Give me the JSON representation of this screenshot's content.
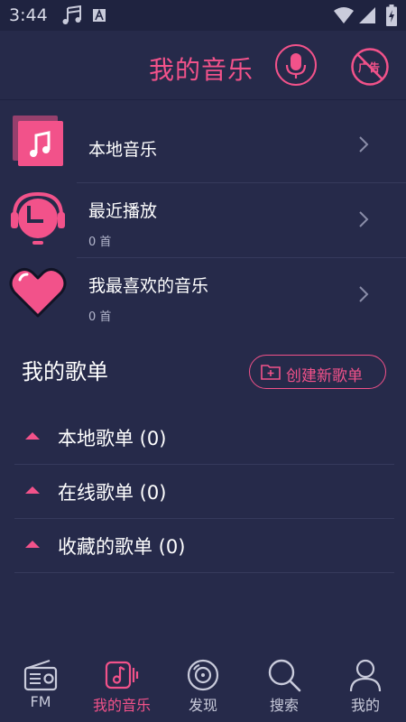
{
  "status_bar": {
    "time": "3:44"
  },
  "header": {
    "title": "我的音乐",
    "ad_label": "广告"
  },
  "library": [
    {
      "title": "本地音乐",
      "subtitle": ""
    },
    {
      "title": "最近播放",
      "subtitle": "0 首"
    },
    {
      "title": "我最喜欢的音乐",
      "subtitle": "0 首"
    }
  ],
  "playlists": {
    "title": "我的歌单",
    "create_label": "创建新歌单",
    "groups": [
      {
        "label": "本地歌单 (0)"
      },
      {
        "label": "在线歌单 (0)"
      },
      {
        "label": "收藏的歌单 (0)"
      }
    ]
  },
  "bottom_nav": [
    {
      "label": "FM",
      "icon": "radio-icon",
      "active": false
    },
    {
      "label": "我的音乐",
      "icon": "music-note-icon",
      "active": true
    },
    {
      "label": "发现",
      "icon": "disc-icon",
      "active": false
    },
    {
      "label": "搜索",
      "icon": "search-icon",
      "active": false
    },
    {
      "label": "我的",
      "icon": "user-icon",
      "active": false
    }
  ],
  "colors": {
    "accent": "#f2528a",
    "background": "#262a4a",
    "text": "#ffffff",
    "muted": "#b3b6cc"
  }
}
